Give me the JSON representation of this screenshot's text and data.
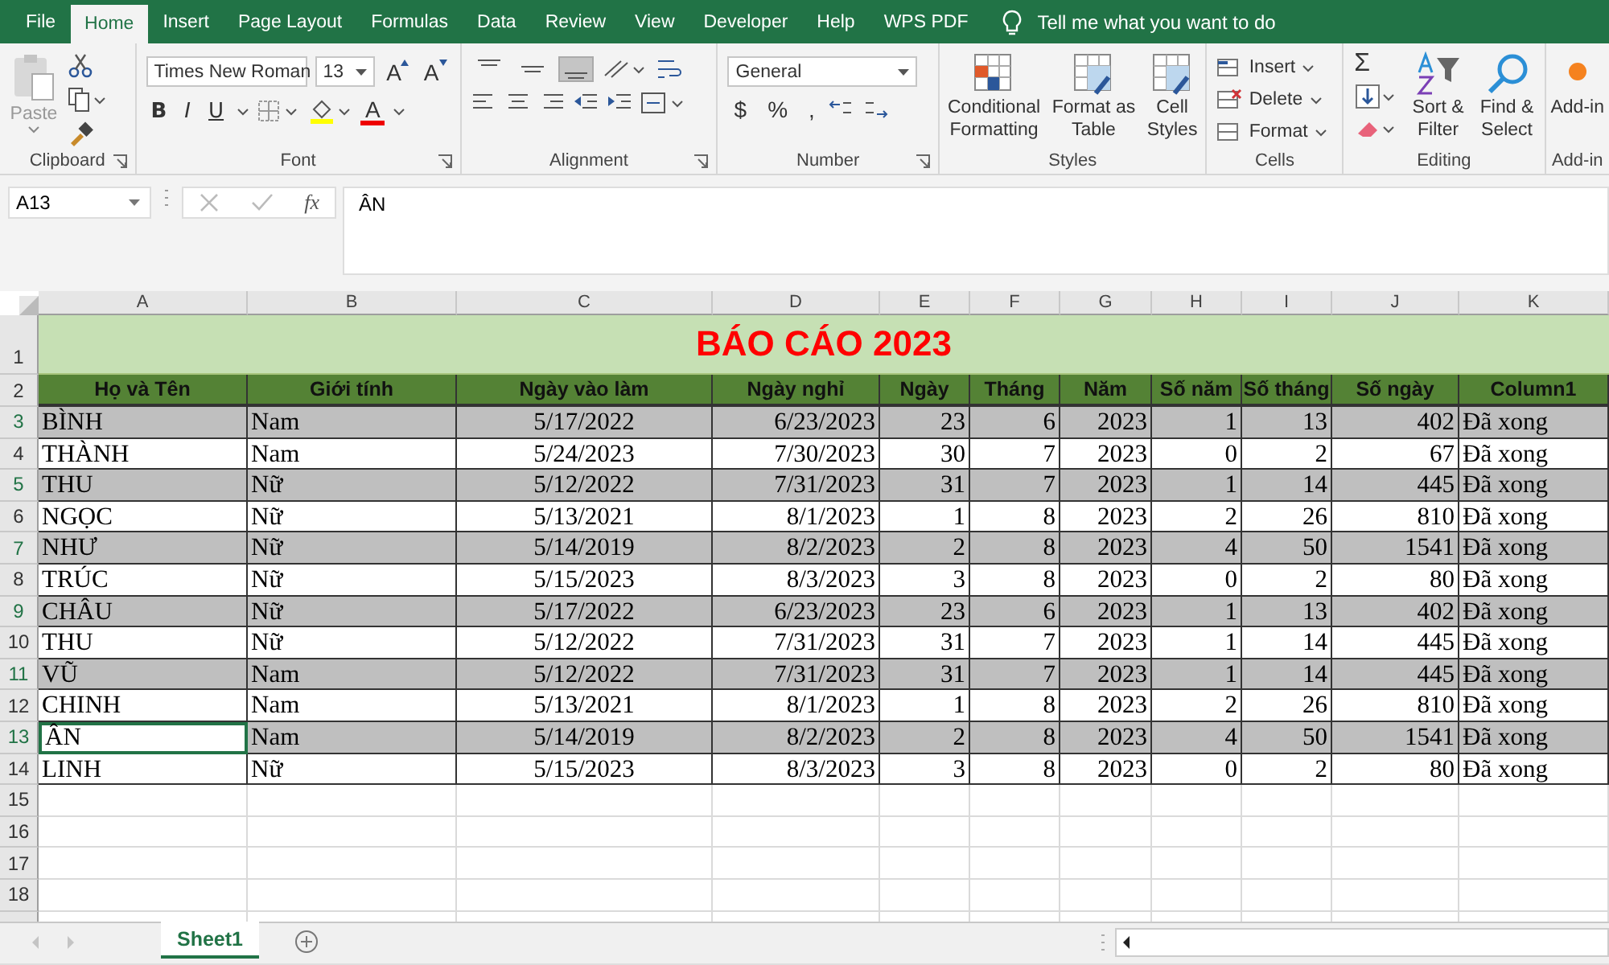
{
  "menu_tabs": [
    {
      "label": "File",
      "selected": false
    },
    {
      "label": "Home",
      "selected": true
    },
    {
      "label": "Insert",
      "selected": false
    },
    {
      "label": "Page Layout",
      "selected": false
    },
    {
      "label": "Formulas",
      "selected": false
    },
    {
      "label": "Data",
      "selected": false
    },
    {
      "label": "Review",
      "selected": false
    },
    {
      "label": "View",
      "selected": false
    },
    {
      "label": "Developer",
      "selected": false
    },
    {
      "label": "Help",
      "selected": false
    },
    {
      "label": "WPS PDF",
      "selected": false
    }
  ],
  "tell_me": {
    "placeholder": "Tell me what you want to do"
  },
  "ribbon": {
    "clipboard": {
      "paste": "Paste",
      "label": "Clipboard"
    },
    "font": {
      "name": "Times New Roman",
      "size": "13",
      "grow": "A",
      "shrink": "A",
      "styles": [
        "B",
        "I",
        "U"
      ],
      "color_letter": "A",
      "label": "Font"
    },
    "alignment": {
      "vertical": [
        {
          "selected": false
        },
        {
          "selected": false
        },
        {
          "selected": true
        }
      ],
      "label": "Alignment"
    },
    "number": {
      "format": "General",
      "symbols": [
        "$",
        "%",
        ","
      ],
      "label": "Number"
    },
    "styles": {
      "buttons": [
        {
          "lines": [
            "Conditional",
            "Formatting"
          ]
        },
        {
          "lines": [
            "Format as",
            "Table"
          ]
        },
        {
          "lines": [
            "Cell",
            "Styles"
          ]
        }
      ],
      "label": "Styles"
    },
    "cells": {
      "buttons": [
        "Insert",
        "Delete",
        "Format"
      ],
      "label": "Cells"
    },
    "editing": {
      "sum": "Σ",
      "buttons": [
        {
          "lines": [
            "Sort &",
            "Filter"
          ]
        },
        {
          "lines": [
            "Find &",
            "Select"
          ]
        }
      ],
      "label": "Editing"
    },
    "addins": {
      "button": "Add-in",
      "label": "Add-in"
    }
  },
  "formula_bar": {
    "name_box": "A13",
    "fx": "fx",
    "formula": "ÂN"
  },
  "sheet": {
    "columns": [
      "A",
      "B",
      "C",
      "D",
      "E",
      "F",
      "G",
      "H",
      "I",
      "J",
      "K"
    ],
    "title_row": "1",
    "title": "BÁO CÁO 2023",
    "header_row": "2",
    "headers": [
      "Họ và Tên",
      "Giới tính",
      "Ngày vào làm",
      "Ngày nghỉ",
      "Ngày",
      "Tháng",
      "Năm",
      "Số năm",
      "Số tháng",
      "Số ngày",
      "Column1"
    ],
    "rows": [
      {
        "number": "3",
        "shaded": true,
        "selected": false,
        "cells": [
          "BÌNH",
          "Nam",
          "5/17/2022",
          "6/23/2023",
          "23",
          "6",
          "2023",
          "1",
          "13",
          "402",
          "Đã xong"
        ]
      },
      {
        "number": "4",
        "shaded": false,
        "selected": false,
        "cells": [
          "THÀNH",
          "Nam",
          "5/24/2023",
          "7/30/2023",
          "30",
          "7",
          "2023",
          "0",
          "2",
          "67",
          "Đã xong"
        ]
      },
      {
        "number": "5",
        "shaded": true,
        "selected": false,
        "cells": [
          "THU",
          "Nữ",
          "5/12/2022",
          "7/31/2023",
          "31",
          "7",
          "2023",
          "1",
          "14",
          "445",
          "Đã xong"
        ]
      },
      {
        "number": "6",
        "shaded": false,
        "selected": false,
        "cells": [
          "NGỌC",
          "Nữ",
          "5/13/2021",
          "8/1/2023",
          "1",
          "8",
          "2023",
          "2",
          "26",
          "810",
          "Đã xong"
        ]
      },
      {
        "number": "7",
        "shaded": true,
        "selected": false,
        "cells": [
          "NHƯ",
          "Nữ",
          "5/14/2019",
          "8/2/2023",
          "2",
          "8",
          "2023",
          "4",
          "50",
          "1541",
          "Đã xong"
        ]
      },
      {
        "number": "8",
        "shaded": false,
        "selected": false,
        "cells": [
          "TRÚC",
          "Nữ",
          "5/15/2023",
          "8/3/2023",
          "3",
          "8",
          "2023",
          "0",
          "2",
          "80",
          "Đã xong"
        ]
      },
      {
        "number": "9",
        "shaded": true,
        "selected": false,
        "cells": [
          "CHÂU",
          "Nữ",
          "5/17/2022",
          "6/23/2023",
          "23",
          "6",
          "2023",
          "1",
          "13",
          "402",
          "Đã xong"
        ]
      },
      {
        "number": "10",
        "shaded": false,
        "selected": false,
        "cells": [
          "THU",
          "Nữ",
          "5/12/2022",
          "7/31/2023",
          "31",
          "7",
          "2023",
          "1",
          "14",
          "445",
          "Đã xong"
        ]
      },
      {
        "number": "11",
        "shaded": true,
        "selected": false,
        "cells": [
          "VŨ",
          "Nam",
          "5/12/2022",
          "7/31/2023",
          "31",
          "7",
          "2023",
          "1",
          "14",
          "445",
          "Đã xong"
        ]
      },
      {
        "number": "12",
        "shaded": false,
        "selected": false,
        "cells": [
          "CHINH",
          "Nam",
          "5/13/2021",
          "8/1/2023",
          "1",
          "8",
          "2023",
          "2",
          "26",
          "810",
          "Đã xong"
        ]
      },
      {
        "number": "13",
        "shaded": true,
        "selected": true,
        "cells": [
          "ÂN",
          "Nam",
          "5/14/2019",
          "8/2/2023",
          "2",
          "8",
          "2023",
          "4",
          "50",
          "1541",
          "Đã xong"
        ]
      },
      {
        "number": "14",
        "shaded": false,
        "selected": false,
        "cells": [
          "LINH",
          "Nữ",
          "5/15/2023",
          "8/3/2023",
          "3",
          "8",
          "2023",
          "0",
          "2",
          "80",
          "Đã xong"
        ]
      }
    ],
    "empty_rows": [
      "15",
      "16",
      "17",
      "18"
    ]
  },
  "sheet_tabs": [
    {
      "label": "Sheet1",
      "selected": true
    }
  ]
}
